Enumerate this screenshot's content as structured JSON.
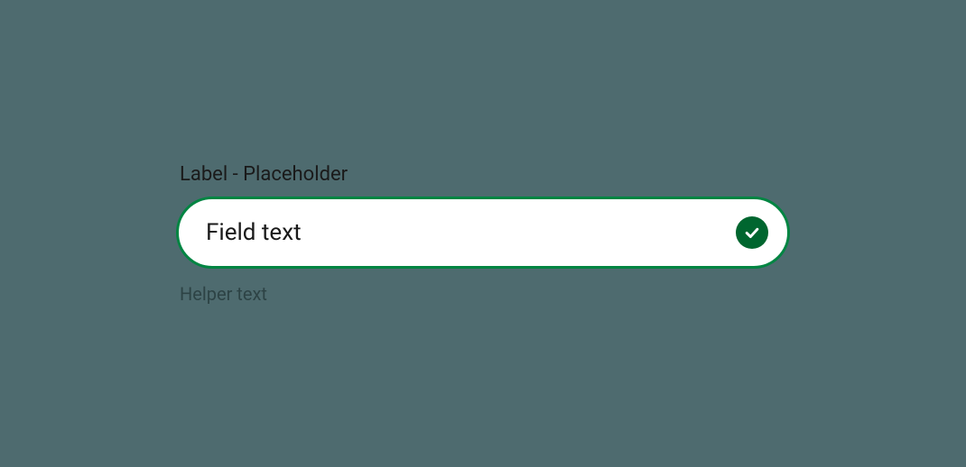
{
  "field": {
    "label": "Label - Placeholder",
    "value": "Field text",
    "helper": "Helper text"
  },
  "colors": {
    "background": "#4e6b6f",
    "border_success": "#008542",
    "badge_success": "#00662f",
    "input_bg": "#ffffff"
  }
}
